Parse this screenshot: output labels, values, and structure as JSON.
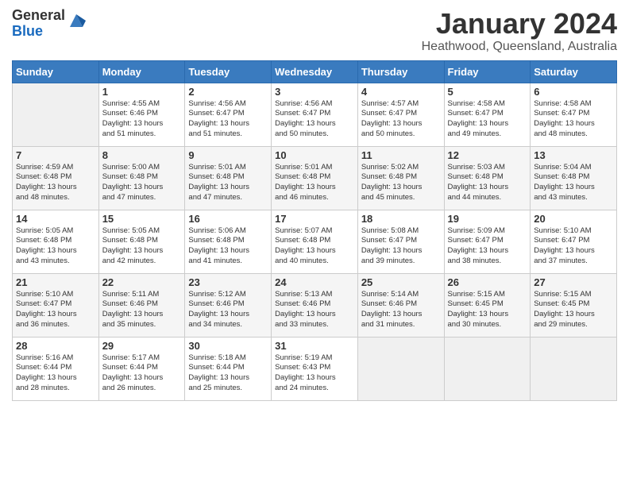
{
  "header": {
    "logo_general": "General",
    "logo_blue": "Blue",
    "month_title": "January 2024",
    "location": "Heathwood, Queensland, Australia"
  },
  "days_of_week": [
    "Sunday",
    "Monday",
    "Tuesday",
    "Wednesday",
    "Thursday",
    "Friday",
    "Saturday"
  ],
  "weeks": [
    [
      {
        "day": "",
        "sunrise": "",
        "sunset": "",
        "daylight": ""
      },
      {
        "day": "1",
        "sunrise": "4:55 AM",
        "sunset": "6:46 PM",
        "daylight": "13 hours and 51 minutes."
      },
      {
        "day": "2",
        "sunrise": "4:56 AM",
        "sunset": "6:47 PM",
        "daylight": "13 hours and 51 minutes."
      },
      {
        "day": "3",
        "sunrise": "4:56 AM",
        "sunset": "6:47 PM",
        "daylight": "13 hours and 50 minutes."
      },
      {
        "day": "4",
        "sunrise": "4:57 AM",
        "sunset": "6:47 PM",
        "daylight": "13 hours and 50 minutes."
      },
      {
        "day": "5",
        "sunrise": "4:58 AM",
        "sunset": "6:47 PM",
        "daylight": "13 hours and 49 minutes."
      },
      {
        "day": "6",
        "sunrise": "4:58 AM",
        "sunset": "6:47 PM",
        "daylight": "13 hours and 48 minutes."
      }
    ],
    [
      {
        "day": "7",
        "sunrise": "4:59 AM",
        "sunset": "6:48 PM",
        "daylight": "13 hours and 48 minutes."
      },
      {
        "day": "8",
        "sunrise": "5:00 AM",
        "sunset": "6:48 PM",
        "daylight": "13 hours and 47 minutes."
      },
      {
        "day": "9",
        "sunrise": "5:01 AM",
        "sunset": "6:48 PM",
        "daylight": "13 hours and 47 minutes."
      },
      {
        "day": "10",
        "sunrise": "5:01 AM",
        "sunset": "6:48 PM",
        "daylight": "13 hours and 46 minutes."
      },
      {
        "day": "11",
        "sunrise": "5:02 AM",
        "sunset": "6:48 PM",
        "daylight": "13 hours and 45 minutes."
      },
      {
        "day": "12",
        "sunrise": "5:03 AM",
        "sunset": "6:48 PM",
        "daylight": "13 hours and 44 minutes."
      },
      {
        "day": "13",
        "sunrise": "5:04 AM",
        "sunset": "6:48 PM",
        "daylight": "13 hours and 43 minutes."
      }
    ],
    [
      {
        "day": "14",
        "sunrise": "5:05 AM",
        "sunset": "6:48 PM",
        "daylight": "13 hours and 43 minutes."
      },
      {
        "day": "15",
        "sunrise": "5:05 AM",
        "sunset": "6:48 PM",
        "daylight": "13 hours and 42 minutes."
      },
      {
        "day": "16",
        "sunrise": "5:06 AM",
        "sunset": "6:48 PM",
        "daylight": "13 hours and 41 minutes."
      },
      {
        "day": "17",
        "sunrise": "5:07 AM",
        "sunset": "6:48 PM",
        "daylight": "13 hours and 40 minutes."
      },
      {
        "day": "18",
        "sunrise": "5:08 AM",
        "sunset": "6:47 PM",
        "daylight": "13 hours and 39 minutes."
      },
      {
        "day": "19",
        "sunrise": "5:09 AM",
        "sunset": "6:47 PM",
        "daylight": "13 hours and 38 minutes."
      },
      {
        "day": "20",
        "sunrise": "5:10 AM",
        "sunset": "6:47 PM",
        "daylight": "13 hours and 37 minutes."
      }
    ],
    [
      {
        "day": "21",
        "sunrise": "5:10 AM",
        "sunset": "6:47 PM",
        "daylight": "13 hours and 36 minutes."
      },
      {
        "day": "22",
        "sunrise": "5:11 AM",
        "sunset": "6:46 PM",
        "daylight": "13 hours and 35 minutes."
      },
      {
        "day": "23",
        "sunrise": "5:12 AM",
        "sunset": "6:46 PM",
        "daylight": "13 hours and 34 minutes."
      },
      {
        "day": "24",
        "sunrise": "5:13 AM",
        "sunset": "6:46 PM",
        "daylight": "13 hours and 33 minutes."
      },
      {
        "day": "25",
        "sunrise": "5:14 AM",
        "sunset": "6:46 PM",
        "daylight": "13 hours and 31 minutes."
      },
      {
        "day": "26",
        "sunrise": "5:15 AM",
        "sunset": "6:45 PM",
        "daylight": "13 hours and 30 minutes."
      },
      {
        "day": "27",
        "sunrise": "5:15 AM",
        "sunset": "6:45 PM",
        "daylight": "13 hours and 29 minutes."
      }
    ],
    [
      {
        "day": "28",
        "sunrise": "5:16 AM",
        "sunset": "6:44 PM",
        "daylight": "13 hours and 28 minutes."
      },
      {
        "day": "29",
        "sunrise": "5:17 AM",
        "sunset": "6:44 PM",
        "daylight": "13 hours and 26 minutes."
      },
      {
        "day": "30",
        "sunrise": "5:18 AM",
        "sunset": "6:44 PM",
        "daylight": "13 hours and 25 minutes."
      },
      {
        "day": "31",
        "sunrise": "5:19 AM",
        "sunset": "6:43 PM",
        "daylight": "13 hours and 24 minutes."
      },
      {
        "day": "",
        "sunrise": "",
        "sunset": "",
        "daylight": ""
      },
      {
        "day": "",
        "sunrise": "",
        "sunset": "",
        "daylight": ""
      },
      {
        "day": "",
        "sunrise": "",
        "sunset": "",
        "daylight": ""
      }
    ]
  ]
}
